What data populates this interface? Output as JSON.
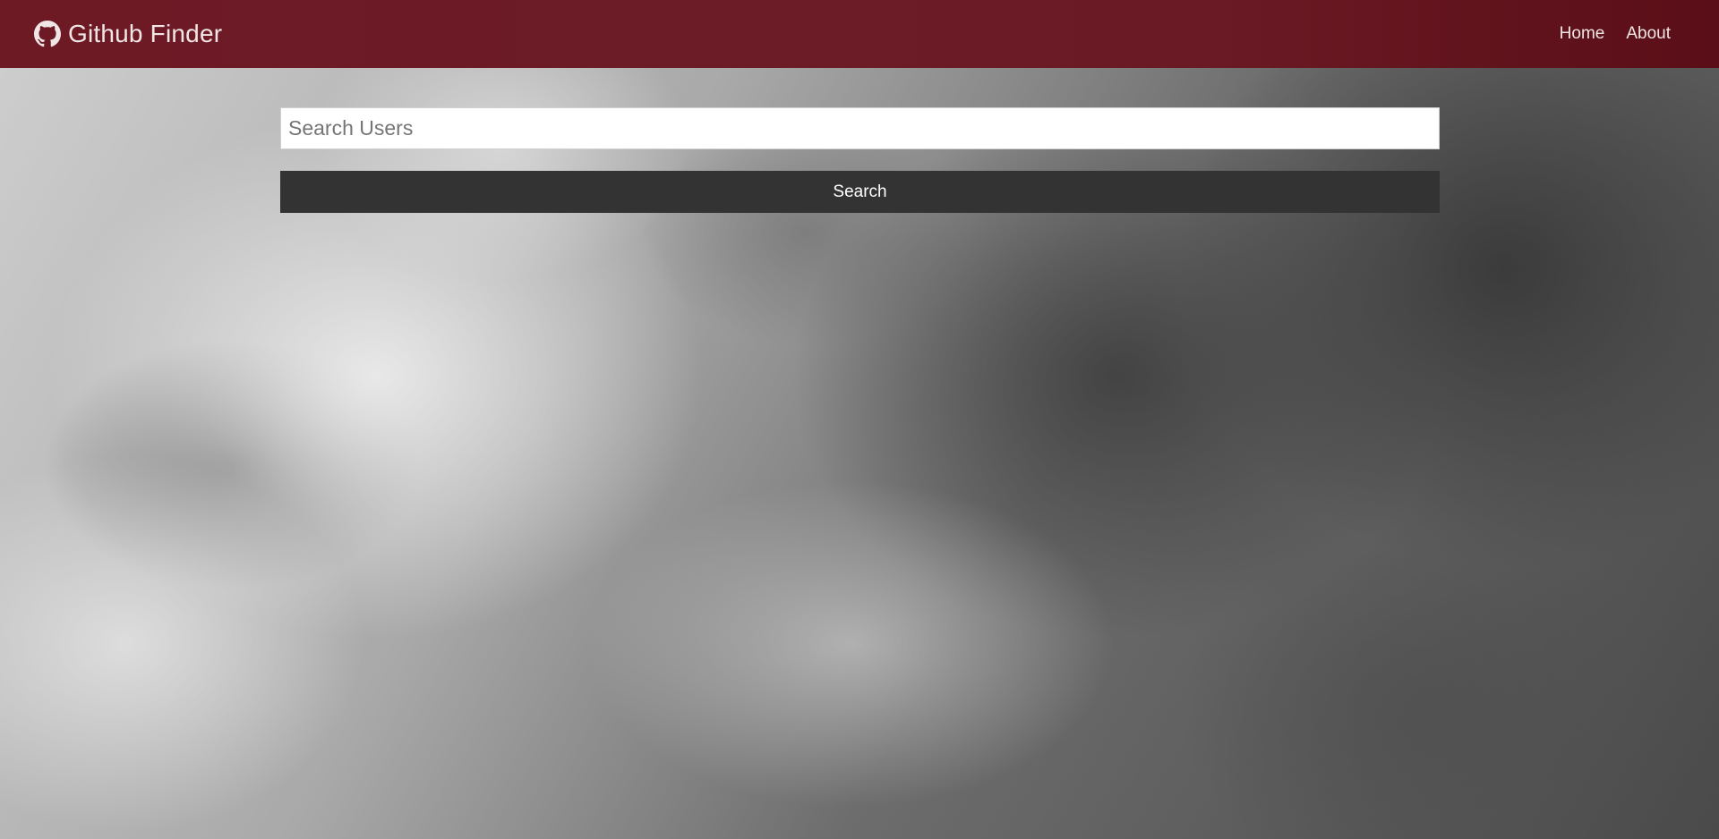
{
  "navbar": {
    "brand_icon": "github-icon",
    "title": "Github Finder",
    "links": [
      {
        "label": "Home"
      },
      {
        "label": "About"
      }
    ],
    "background_color": "#6b1c27"
  },
  "search": {
    "placeholder": "Search Users",
    "value": "",
    "button_label": "Search",
    "button_color": "#333333"
  }
}
